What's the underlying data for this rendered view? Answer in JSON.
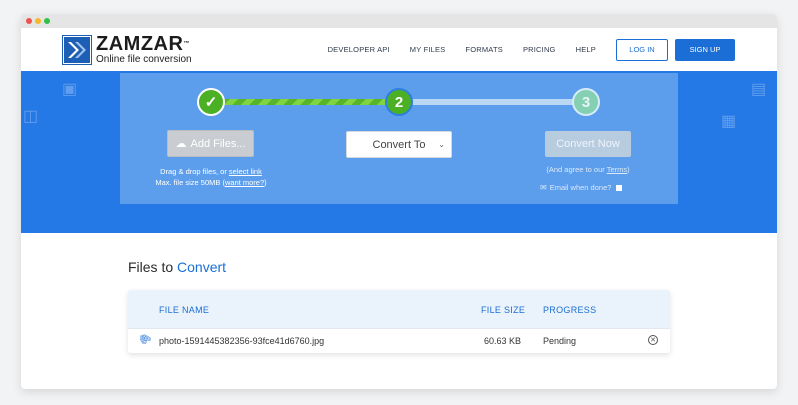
{
  "brand": {
    "name": "ZAMZAR",
    "trademark": "™",
    "tagline": "Online file conversion"
  },
  "nav": {
    "links": [
      "DEVELOPER API",
      "MY FILES",
      "FORMATS",
      "PRICING",
      "HELP"
    ],
    "login": "LOG IN",
    "signup": "SIGN UP"
  },
  "steps": {
    "step1": "✓",
    "step2": "2",
    "step3": "3"
  },
  "upload": {
    "add_files": "Add Files...",
    "drop_prefix": "Drag & drop files, or ",
    "select_link": "select link",
    "max_prefix": "Max. file size 50MB (",
    "want_more": "want more?",
    "max_suffix": ")"
  },
  "convert": {
    "convert_to": "Convert To",
    "convert_now": "Convert Now",
    "agree_prefix": "(And agree to our ",
    "terms": "Terms",
    "agree_suffix": ")",
    "email_label": "Email when done?"
  },
  "files": {
    "title_part1": "Files to",
    "title_part2": "Convert",
    "columns": [
      "FILE NAME",
      "FILE SIZE",
      "PROGRESS"
    ],
    "rows": [
      {
        "name": "photo-1591445382356-93fce41d6760.jpg",
        "size": "60.63 KB",
        "progress": "Pending"
      }
    ]
  },
  "colors": {
    "accent": "#1a6ed6",
    "hero": "#2479e6",
    "success": "#4bb024"
  }
}
